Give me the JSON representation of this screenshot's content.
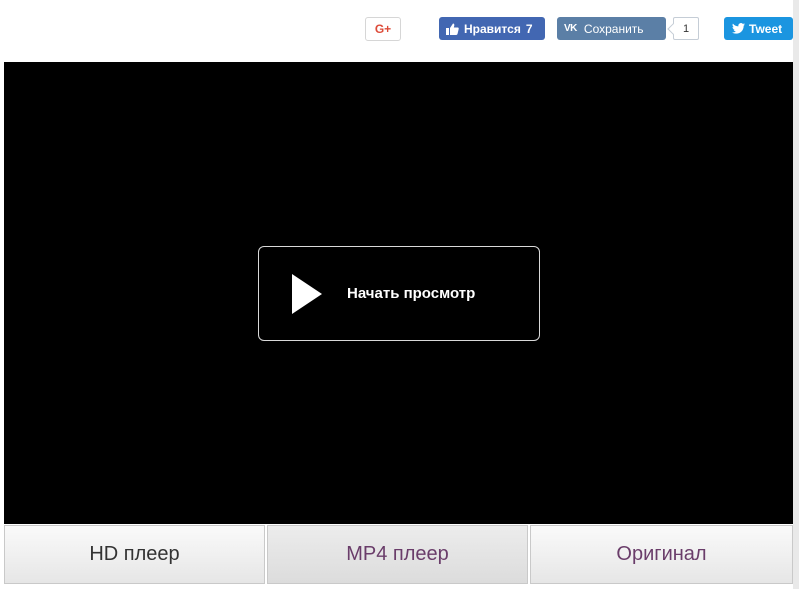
{
  "social": {
    "gplus": {
      "label": "G+",
      "icon": "google-plus-icon",
      "color": "#dd4b39"
    },
    "facebook_like": {
      "label": "Нравится",
      "count": "7",
      "icon": "thumbs-up-icon",
      "color": "#4267b2"
    },
    "vk_share": {
      "icon_text": "VK",
      "label": "Сохранить",
      "count": "1",
      "color": "#5b7fa6"
    },
    "twitter": {
      "label": "Tweet",
      "icon": "twitter-bird-icon",
      "color": "#1b95e0"
    }
  },
  "player": {
    "background": "#000000",
    "play_button": {
      "icon": "play-icon",
      "label": "Начать просмотр"
    }
  },
  "tabs": [
    {
      "label": "HD плеер"
    },
    {
      "label": "MP4 плеер"
    },
    {
      "label": "Оригинал"
    }
  ]
}
